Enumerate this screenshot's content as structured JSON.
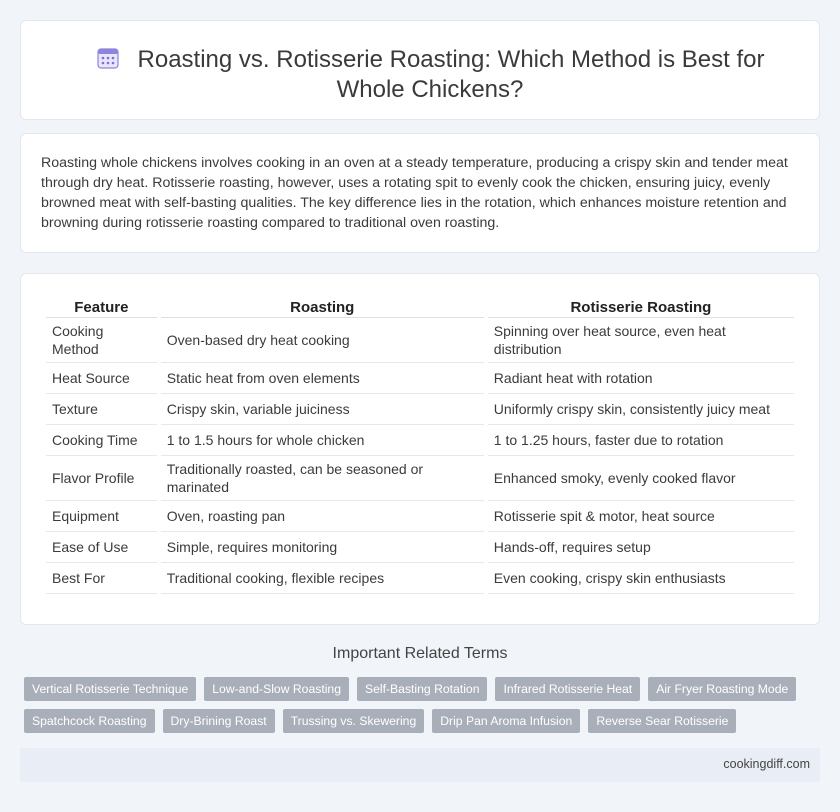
{
  "header": {
    "title": "Roasting vs. Rotisserie Roasting: Which Method is Best for Whole Chickens?",
    "icon": "calendar-icon"
  },
  "intro": {
    "text": "Roasting whole chickens involves cooking in an oven at a steady temperature, producing a crispy skin and tender meat through dry heat. Rotisserie roasting, however, uses a rotating spit to evenly cook the chicken, ensuring juicy, evenly browned meat with self-basting qualities. The key difference lies in the rotation, which enhances moisture retention and browning during rotisserie roasting compared to traditional oven roasting."
  },
  "table": {
    "headers": [
      "Feature",
      "Roasting",
      "Rotisserie Roasting"
    ],
    "rows": [
      [
        "Cooking Method",
        "Oven-based dry heat cooking",
        "Spinning over heat source, even heat distribution"
      ],
      [
        "Heat Source",
        "Static heat from oven elements",
        "Radiant heat with rotation"
      ],
      [
        "Texture",
        "Crispy skin, variable juiciness",
        "Uniformly crispy skin, consistently juicy meat"
      ],
      [
        "Cooking Time",
        "1 to 1.5 hours for whole chicken",
        "1 to 1.25 hours, faster due to rotation"
      ],
      [
        "Flavor Profile",
        "Traditionally roasted, can be seasoned or marinated",
        "Enhanced smoky, evenly cooked flavor"
      ],
      [
        "Equipment",
        "Oven, roasting pan",
        "Rotisserie spit & motor, heat source"
      ],
      [
        "Ease of Use",
        "Simple, requires monitoring",
        "Hands-off, requires setup"
      ],
      [
        "Best For",
        "Traditional cooking, flexible recipes",
        "Even cooking, crispy skin enthusiasts"
      ]
    ]
  },
  "related": {
    "heading": "Important Related Terms",
    "terms": [
      "Vertical Rotisserie Technique",
      "Low-and-Slow Roasting",
      "Self-Basting Rotation",
      "Infrared Rotisserie Heat",
      "Air Fryer Roasting Mode",
      "Spatchcock Roasting",
      "Dry-Brining Roast",
      "Trussing vs. Skewering",
      "Drip Pan Aroma Infusion",
      "Reverse Sear Rotisserie"
    ]
  },
  "footer": {
    "site": "cookingdiff.com"
  },
  "colors": {
    "background": "#f1f4f9",
    "card": "#ffffff",
    "tag": "#a9afb8",
    "footer": "#e8edf6",
    "icon_accent": "#7b6fd6"
  }
}
